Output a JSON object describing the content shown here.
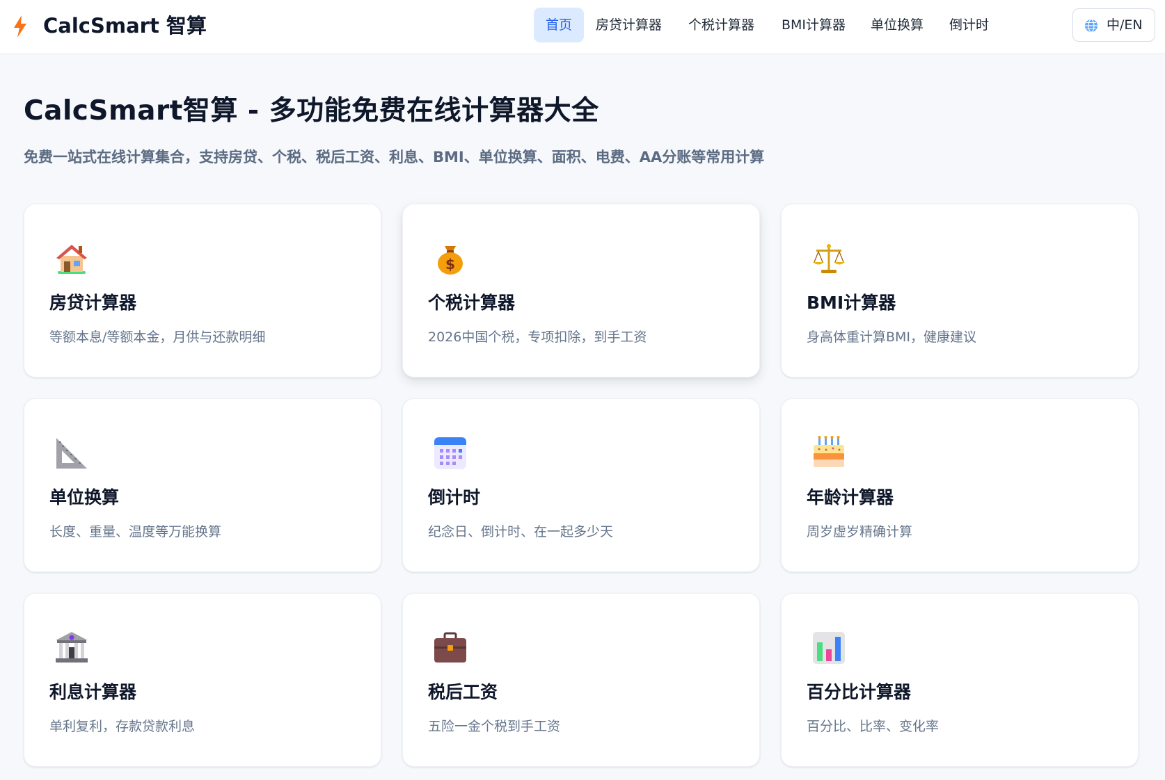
{
  "header": {
    "brand": "CalcSmart 智算",
    "logo_icon": "lightning-bolt-icon",
    "nav": [
      {
        "label": "首页",
        "active": true
      },
      {
        "label": "房贷计算器",
        "active": false
      },
      {
        "label": "个税计算器",
        "active": false
      },
      {
        "label": "BMI计算器",
        "active": false
      },
      {
        "label": "单位换算",
        "active": false
      },
      {
        "label": "倒计时",
        "active": false
      }
    ],
    "language_toggle": {
      "label": "中/EN",
      "icon": "globe-icon"
    }
  },
  "main": {
    "title": "CalcSmart智算 - 多功能免费在线计算器大全",
    "subtitle": "免费一站式在线计算集合，支持房贷、个税、税后工资、利息、BMI、单位换算、面积、电费、AA分账等常用计算",
    "cards": [
      {
        "icon": "house-icon",
        "title": "房贷计算器",
        "desc": "等额本息/等额本金，月供与还款明细"
      },
      {
        "icon": "money-bag-icon",
        "title": "个税计算器",
        "desc": "2026中国个税，专项扣除，到手工资"
      },
      {
        "icon": "balance-scale-icon",
        "title": "BMI计算器",
        "desc": "身高体重计算BMI，健康建议"
      },
      {
        "icon": "triangular-ruler-icon",
        "title": "单位换算",
        "desc": "长度、重量、温度等万能换算"
      },
      {
        "icon": "calendar-icon",
        "title": "倒计时",
        "desc": "纪念日、倒计时、在一起多少天"
      },
      {
        "icon": "birthday-cake-icon",
        "title": "年龄计算器",
        "desc": "周岁虚岁精确计算"
      },
      {
        "icon": "bank-icon",
        "title": "利息计算器",
        "desc": "单利复利，存款贷款利息"
      },
      {
        "icon": "briefcase-icon",
        "title": "税后工资",
        "desc": "五险一金个税到手工资"
      },
      {
        "icon": "bar-chart-icon",
        "title": "百分比计算器",
        "desc": "百分比、比率、变化率"
      }
    ]
  },
  "colors": {
    "accent": "#2563eb",
    "accent_bg": "#dbeafe",
    "page_bg": "#f6f8fb",
    "text_primary": "#0f172a",
    "text_muted": "#64748b"
  }
}
